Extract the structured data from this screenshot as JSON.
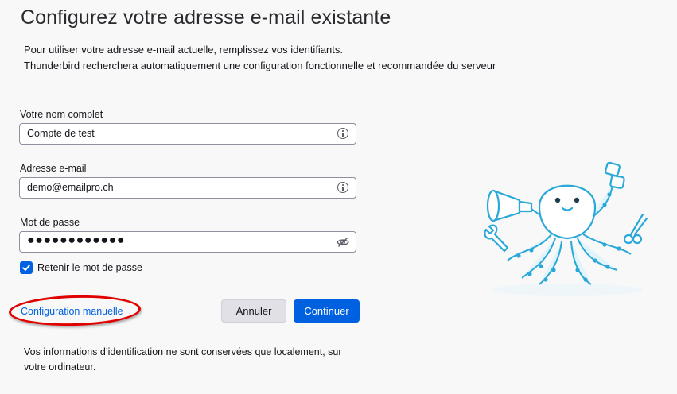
{
  "page": {
    "title": "Configurez votre adresse e-mail existante",
    "description_line1": "Pour utiliser votre adresse e-mail actuelle, remplissez vos identifiants.",
    "description_line2": "Thunderbird recherchera automatiquement une configuration fonctionnelle et recommandée du serveur"
  },
  "form": {
    "name": {
      "label": "Votre nom complet",
      "value": "Compte de test"
    },
    "email": {
      "label": "Adresse e-mail",
      "value": "demo@emailpro.ch"
    },
    "password": {
      "label": "Mot de passe",
      "value": "●●●●●●●●●●●●"
    },
    "remember": {
      "label": "Retenir le mot de passe",
      "checked": true
    }
  },
  "actions": {
    "manual_config": "Configuration manuelle",
    "cancel": "Annuler",
    "continue": "Continuer"
  },
  "footer": {
    "text": "Vos informations d’identification ne sont conservées que localement, sur votre ordinateur."
  },
  "icons": {
    "info": "info-icon",
    "password_visibility": "eye-slash-icon",
    "checkbox": "checkmark-icon",
    "illustration": "octopus-illustration"
  },
  "colors": {
    "accent": "#0061e0",
    "annotation": "#e00000"
  }
}
